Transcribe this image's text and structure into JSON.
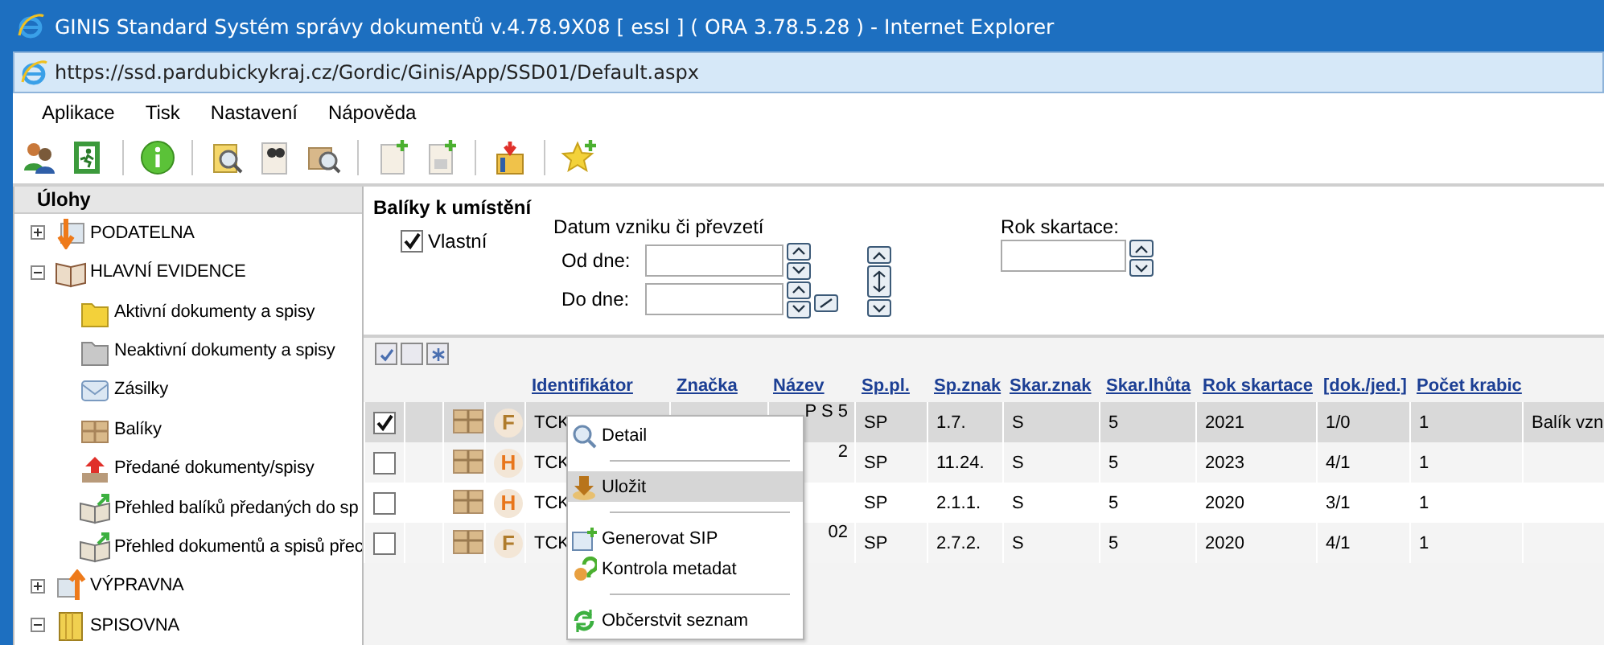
{
  "window": {
    "title": "GINIS Standard Systém správy dokumentů v.4.78.9X08 [ essl ] ( ORA 3.78.5.28 ) - Internet Explorer"
  },
  "address_bar": {
    "url": "https://ssd.pardubickykraj.cz/Gordic/Ginis/App/SSD01/Default.aspx"
  },
  "menu": [
    "Aplikace",
    "Tisk",
    "Nastavení",
    "Nápověda"
  ],
  "sidebar": {
    "title": "Úlohy",
    "items": [
      {
        "label": "PODATELNA",
        "kind": "inbox",
        "expanded": false
      },
      {
        "label": "HLAVNÍ EVIDENCE",
        "kind": "book",
        "expanded": true,
        "children": [
          {
            "label": "Aktivní dokumenty a spisy",
            "kind": "folder"
          },
          {
            "label": "Neaktivní dokumenty a spisy",
            "kind": "grayfolder"
          },
          {
            "label": "Zásilky",
            "kind": "envelope"
          },
          {
            "label": "Balíky",
            "kind": "parcel"
          },
          {
            "label": "Předané dokumenty/spisy",
            "kind": "upload"
          },
          {
            "label": "Přehled balíků předaných do sp",
            "kind": "bookarrow"
          },
          {
            "label": "Přehled dokumentů a spisů přec",
            "kind": "bookarrow"
          }
        ]
      },
      {
        "label": "VÝPRAVNA",
        "kind": "outbox",
        "expanded": false
      },
      {
        "label": "SPISOVNA",
        "kind": "archive",
        "expanded": true
      }
    ]
  },
  "filter": {
    "title": "Balíky k umístění",
    "own": {
      "label": "Vlastní",
      "checked": true
    },
    "date_group": "Datum vzniku či převzetí",
    "from": {
      "label": "Od dne:"
    },
    "to": {
      "label": "Do dne:"
    },
    "shred_year": {
      "label": "Rok skartace:"
    }
  },
  "table": {
    "columns": [
      "Identifikátor",
      "Značka",
      "Název",
      "Sp.pl.",
      "Sp.znak",
      "Skar.znak",
      "Skar.lhůta",
      "Rok skartace",
      "[dok./jed.]",
      "Počet krabic"
    ],
    "rows": [
      {
        "checked": true,
        "selected": true,
        "type": "F",
        "color": "#b07c2c",
        "identifikator": "TCK",
        "nazev": "P S 5",
        "sp_pl": "SP",
        "sp_znak": "1.7.",
        "skar_znak": "S",
        "skar_lhuta": "5",
        "rok_skartace": "2021",
        "dok_jed": "1/0",
        "pocet_krabic": "1",
        "column_11": "Balík vzn"
      },
      {
        "checked": false,
        "selected": false,
        "type": "H",
        "color": "#e8761c",
        "identifikator": "TCK",
        "nazev": "2",
        "sp_pl": "SP",
        "sp_znak": "11.24.",
        "skar_znak": "S",
        "skar_lhuta": "5",
        "rok_skartace": "2023",
        "dok_jed": "4/1",
        "pocet_krabic": "1"
      },
      {
        "checked": false,
        "selected": false,
        "type": "H",
        "color": "#e8761c",
        "identifikator": "TCK",
        "sp_pl": "SP",
        "sp_znak": "2.1.1.",
        "skar_znak": "S",
        "skar_lhuta": "5",
        "rok_skartace": "2020",
        "dok_jed": "3/1",
        "pocet_krabic": "1"
      },
      {
        "checked": false,
        "selected": false,
        "type": "F",
        "color": "#b07c2c",
        "identifikator": "TCK",
        "nazev": "02",
        "sp_pl": "SP",
        "sp_znak": "2.7.2.",
        "skar_znak": "S",
        "skar_lhuta": "5",
        "rok_skartace": "2020",
        "dok_jed": "4/1",
        "pocet_krabic": "1"
      }
    ]
  },
  "context_menu": {
    "items": [
      {
        "kind": "detail",
        "label": "Detail",
        "selected": false
      },
      {
        "kind": "separator"
      },
      {
        "kind": "save",
        "label": "Uložit",
        "selected": true
      },
      {
        "kind": "separator"
      },
      {
        "kind": "generate",
        "label": "Generovat SIP",
        "selected": false
      },
      {
        "kind": "check",
        "label": "Kontrola metadat",
        "selected": false
      },
      {
        "kind": "separator"
      },
      {
        "kind": "refresh",
        "label": "Občerstvit seznam",
        "selected": false
      }
    ]
  }
}
